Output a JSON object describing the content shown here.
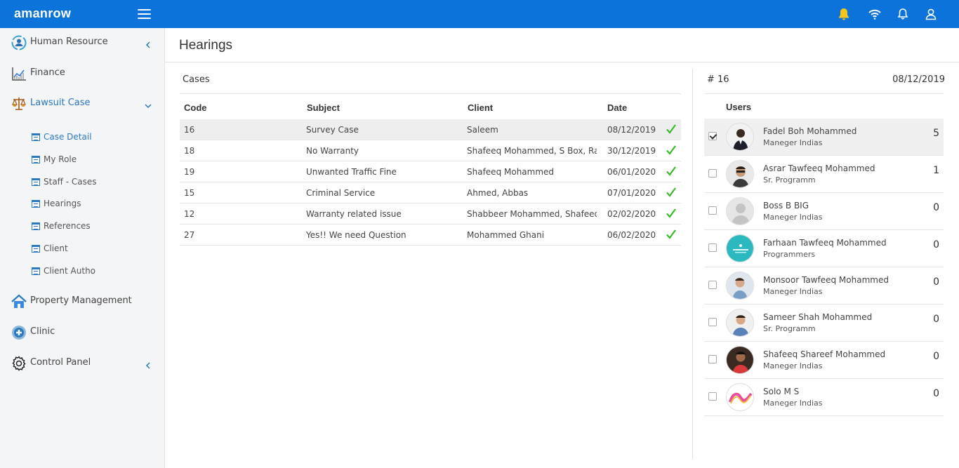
{
  "app": {
    "brand": "amanrow"
  },
  "topbar": {
    "icons": [
      "bell-alert-icon",
      "wifi-icon",
      "bell-icon",
      "user-icon"
    ],
    "accent": "#0b73d9",
    "alert_color": "#f5c518"
  },
  "sidebar": {
    "items": [
      {
        "label": "Human Resource",
        "icon": "human-resource-icon"
      },
      {
        "label": "Finance",
        "icon": "finance-chart-icon"
      },
      {
        "label": "Lawsuit Case",
        "icon": "scales-icon"
      },
      {
        "label": "Property Management",
        "icon": "home-icon"
      },
      {
        "label": "Clinic",
        "icon": "clinic-cross-icon"
      },
      {
        "label": "Control Panel",
        "icon": "gear-icon"
      }
    ],
    "subitems": [
      {
        "label": "Case Detail"
      },
      {
        "label": "My Role"
      },
      {
        "label": "Staff - Cases"
      },
      {
        "label": "Hearings"
      },
      {
        "label": "References"
      },
      {
        "label": "Client"
      },
      {
        "label": "Client Autho"
      }
    ]
  },
  "main": {
    "title": "Hearings",
    "cases": {
      "heading": "Cases",
      "columns": [
        "Code",
        "Subject",
        "Client",
        "Date"
      ],
      "rows": [
        {
          "code": "16",
          "subject": "Survey Case",
          "client": "Saleem",
          "date": "08/12/2019"
        },
        {
          "code": "18",
          "subject": "No Warranty",
          "client": "Shafeeq Mohammed, S Box, Ray ...",
          "date": "30/12/2019"
        },
        {
          "code": "19",
          "subject": "Unwanted Traffic Fine",
          "client": "Shafeeq Mohammed",
          "date": "06/01/2020"
        },
        {
          "code": "15",
          "subject": "Criminal Service",
          "client": "Ahmed, Abbas",
          "date": "07/01/2020"
        },
        {
          "code": "12",
          "subject": "Warranty related issue",
          "client": "Shabbeer Mohammed, Shafeeq ...",
          "date": "02/02/2020"
        },
        {
          "code": "27",
          "subject": "Yes!! We need Question",
          "client": "Mohammed Ghani",
          "date": "06/02/2020"
        }
      ]
    },
    "detail": {
      "case_no": "# 16",
      "date": "08/12/2019",
      "users_heading": "Users",
      "users": [
        {
          "name": "Fadel Boh Mohammed",
          "role": "Maneger Indias",
          "count": "5"
        },
        {
          "name": "Asrar Tawfeeq Mohammed",
          "role": "Sr. Programm",
          "count": "1"
        },
        {
          "name": "Boss B BIG",
          "role": "Maneger Indias",
          "count": "0"
        },
        {
          "name": "Farhaan Tawfeeq Mohammed",
          "role": "Programmers",
          "count": "0"
        },
        {
          "name": "Monsoor Tawfeeq Mohammed",
          "role": "Maneger Indias",
          "count": "0"
        },
        {
          "name": "Sameer Shah Mohammed",
          "role": "Sr. Programm",
          "count": "0"
        },
        {
          "name": "Shafeeq Shareef Mohammed",
          "role": "Maneger Indias",
          "count": "0"
        },
        {
          "name": "Solo M S",
          "role": "Maneger Indias",
          "count": "0"
        }
      ]
    }
  }
}
